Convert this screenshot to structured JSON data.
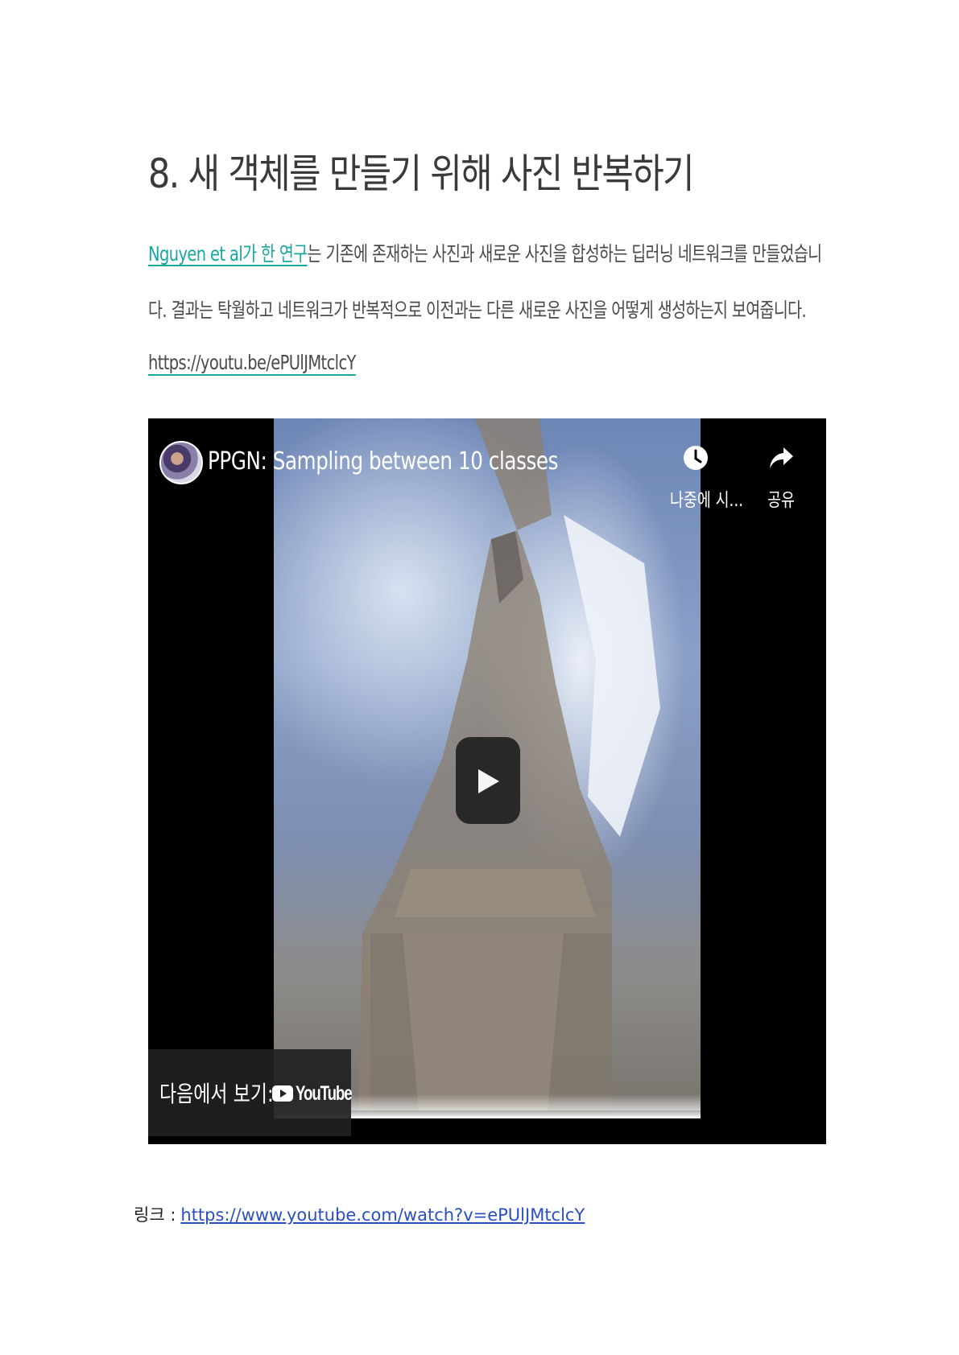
{
  "heading": "8. 새 객체를 만들기 위해 사진 반복하기",
  "paragraph": {
    "link_text": "Nguyen et al가 한 연구",
    "line1_rest": "는 기존에 존재하는 사진과 새로운 사진을 합성하는 딥러닝 네트워크를 만들었습니",
    "line2": "다. 결과는 탁월하고 네트워크가 반복적으로 이전과는 다른 새로운 사진을 어떻게 생성하는지 보여줍니다."
  },
  "short_url": "https://youtu.be/ePUlJMtclcY",
  "video": {
    "title": "PPGN: Sampling between 10 classes",
    "watch_later_label": "나중에 시...",
    "share_label": "공유",
    "watch_on_label": "다음에서 보기:",
    "youtube_word": "YouTube",
    "icons": {
      "avatar": "channel-avatar",
      "watch_later": "clock-icon",
      "share": "share-arrow-icon",
      "play": "play-icon",
      "youtube": "youtube-logo"
    }
  },
  "footer": {
    "label": "링크 :",
    "url": "https://www.youtube.com/watch?v=ePUlJMtclcY"
  },
  "colors": {
    "link_teal": "#1aa7a1",
    "footer_link_blue": "#2a4fc2",
    "video_bg": "#000000"
  }
}
